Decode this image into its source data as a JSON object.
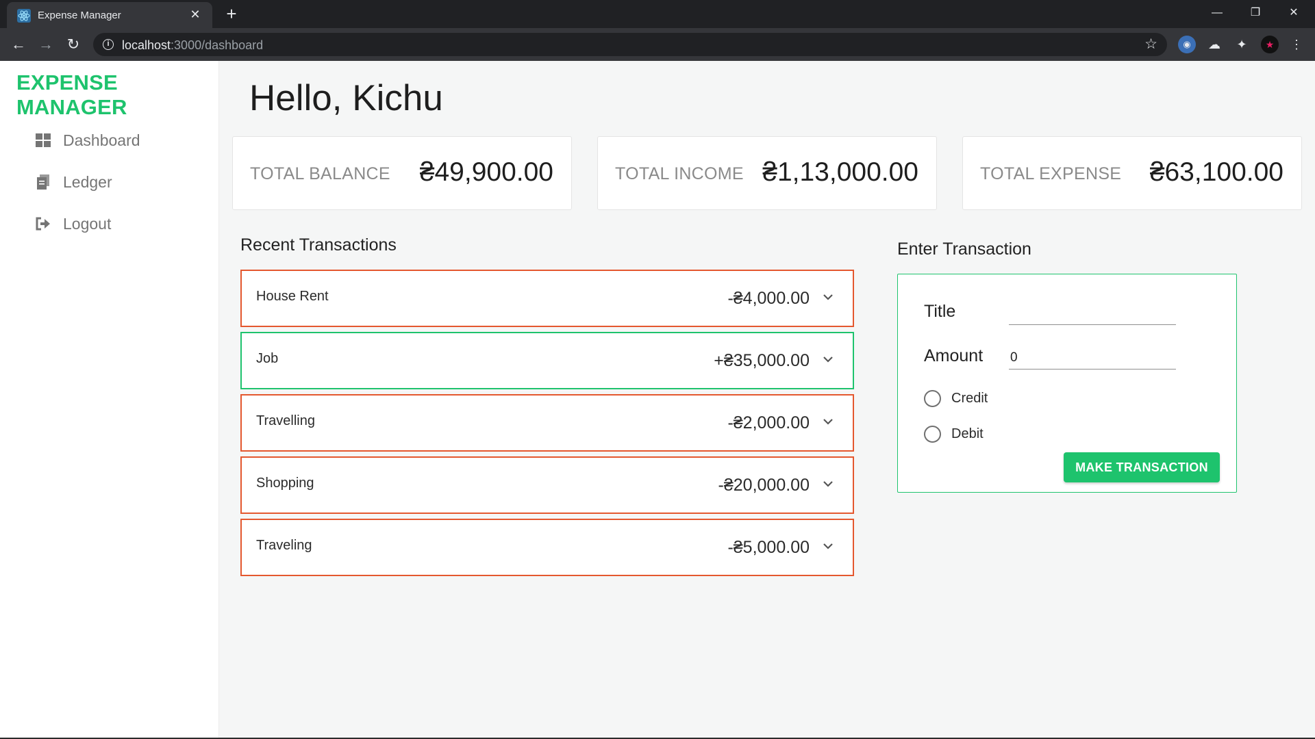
{
  "browser": {
    "tab_title": "Expense Manager",
    "url_host": "localhost",
    "url_path": ":3000/dashboard",
    "window_controls": [
      "—",
      "❐",
      "✕"
    ]
  },
  "sidebar": {
    "brand": "EXPENSE MANAGER",
    "items": [
      {
        "label": "Dashboard",
        "icon": "dashboard-icon"
      },
      {
        "label": "Ledger",
        "icon": "ledger-icon"
      },
      {
        "label": "Logout",
        "icon": "logout-icon"
      }
    ]
  },
  "main": {
    "greeting": "Hello, Kichu",
    "cards": [
      {
        "label": "TOTAL BALANCE",
        "value": "₴49,900.00"
      },
      {
        "label": "TOTAL INCOME",
        "value": "₴1,13,000.00"
      },
      {
        "label": "TOTAL EXPENSE",
        "value": "₴63,100.00"
      }
    ],
    "recent_title": "Recent Transactions",
    "transactions": [
      {
        "title": "House Rent",
        "amount": "-₴4,000.00",
        "type": "debit"
      },
      {
        "title": "Job",
        "amount": "+₴35,000.00",
        "type": "credit"
      },
      {
        "title": "Travelling",
        "amount": "-₴2,000.00",
        "type": "debit"
      },
      {
        "title": "Shopping",
        "amount": "-₴20,000.00",
        "type": "debit"
      },
      {
        "title": "Traveling",
        "amount": "-₴5,000.00",
        "type": "debit"
      }
    ]
  },
  "form": {
    "heading": "Enter Transaction",
    "title_label": "Title",
    "title_value": "",
    "amount_label": "Amount",
    "amount_value": "0",
    "credit_label": "Credit",
    "debit_label": "Debit",
    "submit_label": "MAKE TRANSACTION"
  },
  "colors": {
    "accent": "#1ec36d",
    "debit_border": "#e4572e",
    "credit_border": "#1ec36d"
  }
}
